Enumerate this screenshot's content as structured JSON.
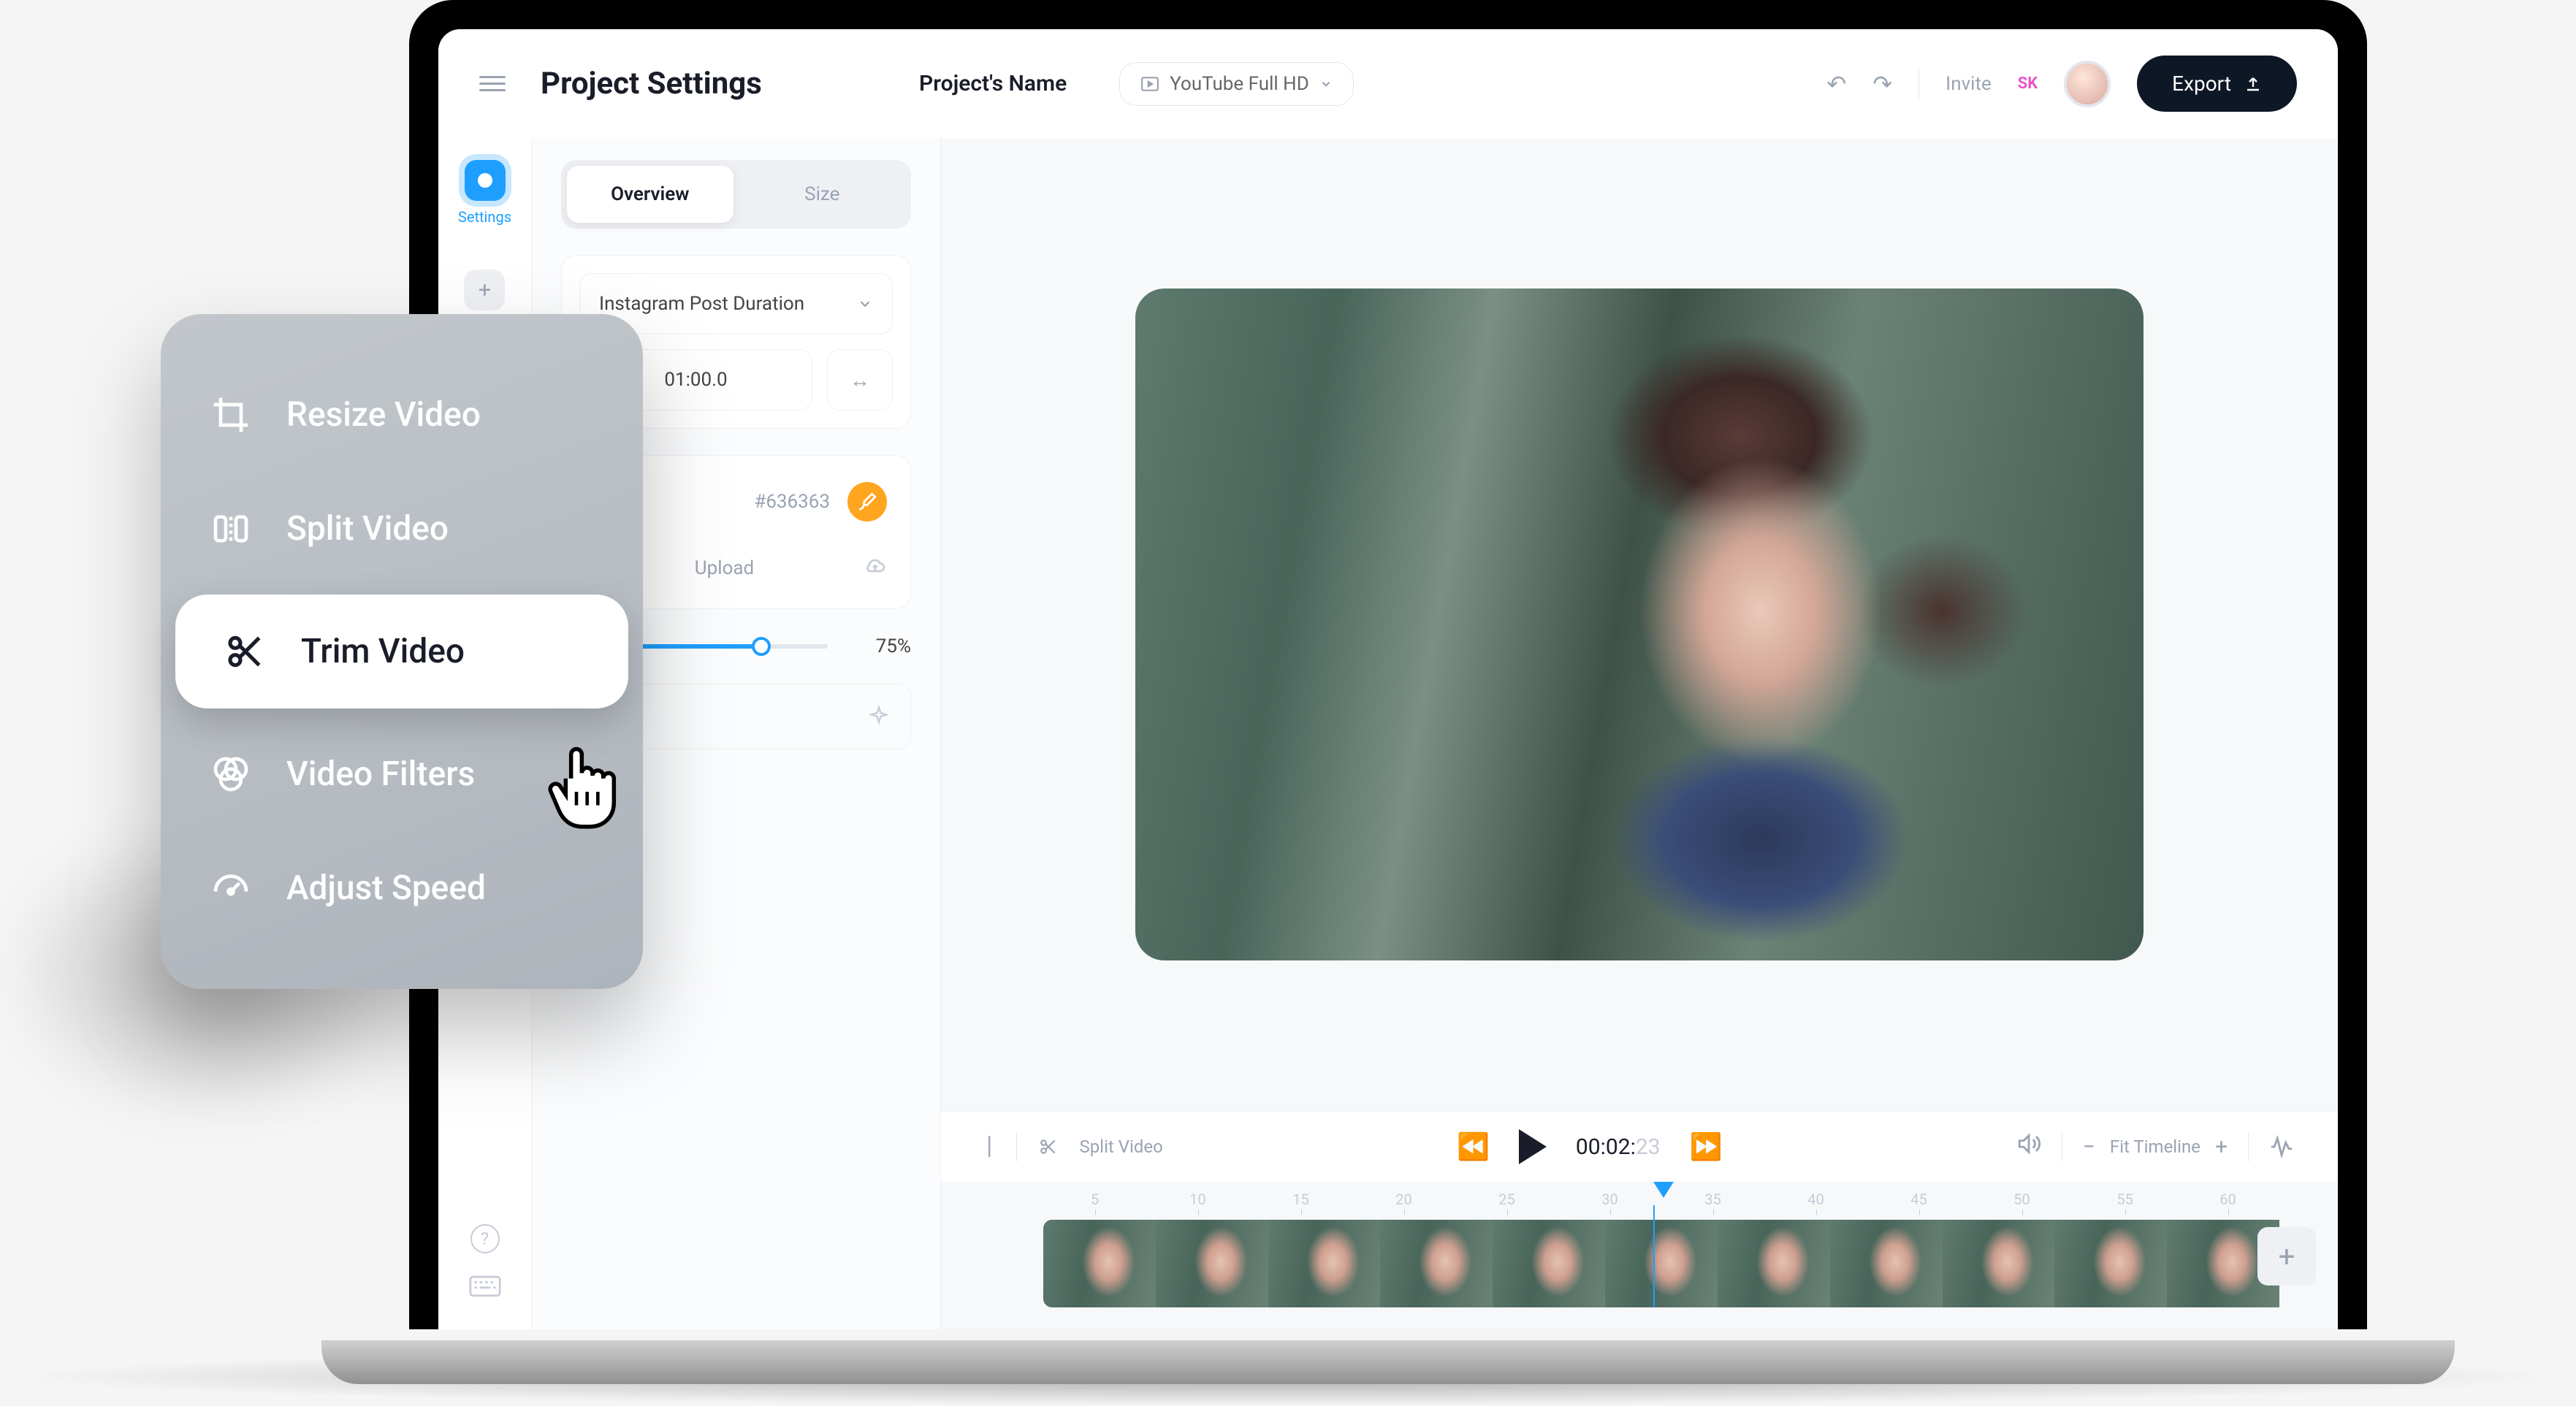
{
  "header": {
    "title": "Project Settings",
    "project_name": "Project's Name",
    "preset": "YouTube Full HD",
    "invite": "Invite",
    "avatar_initials": "SK",
    "export": "Export"
  },
  "nav": {
    "settings": "Settings",
    "upload": "Upload"
  },
  "settings": {
    "tabs": {
      "overview": "Overview",
      "size": "Size"
    },
    "duration_preset": "Instagram Post Duration",
    "duration_value": "01:00.0",
    "color_hex": "#636363",
    "upload_label": "Upload",
    "slider_value": "75%",
    "slider_fill": 75
  },
  "transport": {
    "split_label": "Split Video",
    "timecode_main": "00:02:",
    "timecode_faded": "23",
    "fit_label": "Fit Timeline"
  },
  "ruler": [
    "5",
    "10",
    "15",
    "20",
    "25",
    "30",
    "35",
    "40",
    "45",
    "50",
    "55",
    "60"
  ],
  "overlay": {
    "items": [
      {
        "label": "Resize Video",
        "icon": "crop"
      },
      {
        "label": "Split Video",
        "icon": "split"
      },
      {
        "label": "Trim Video",
        "icon": "scissors"
      },
      {
        "label": "Video Filters",
        "icon": "filters"
      },
      {
        "label": "Adjust Speed",
        "icon": "speed"
      }
    ],
    "active_index": 2
  }
}
